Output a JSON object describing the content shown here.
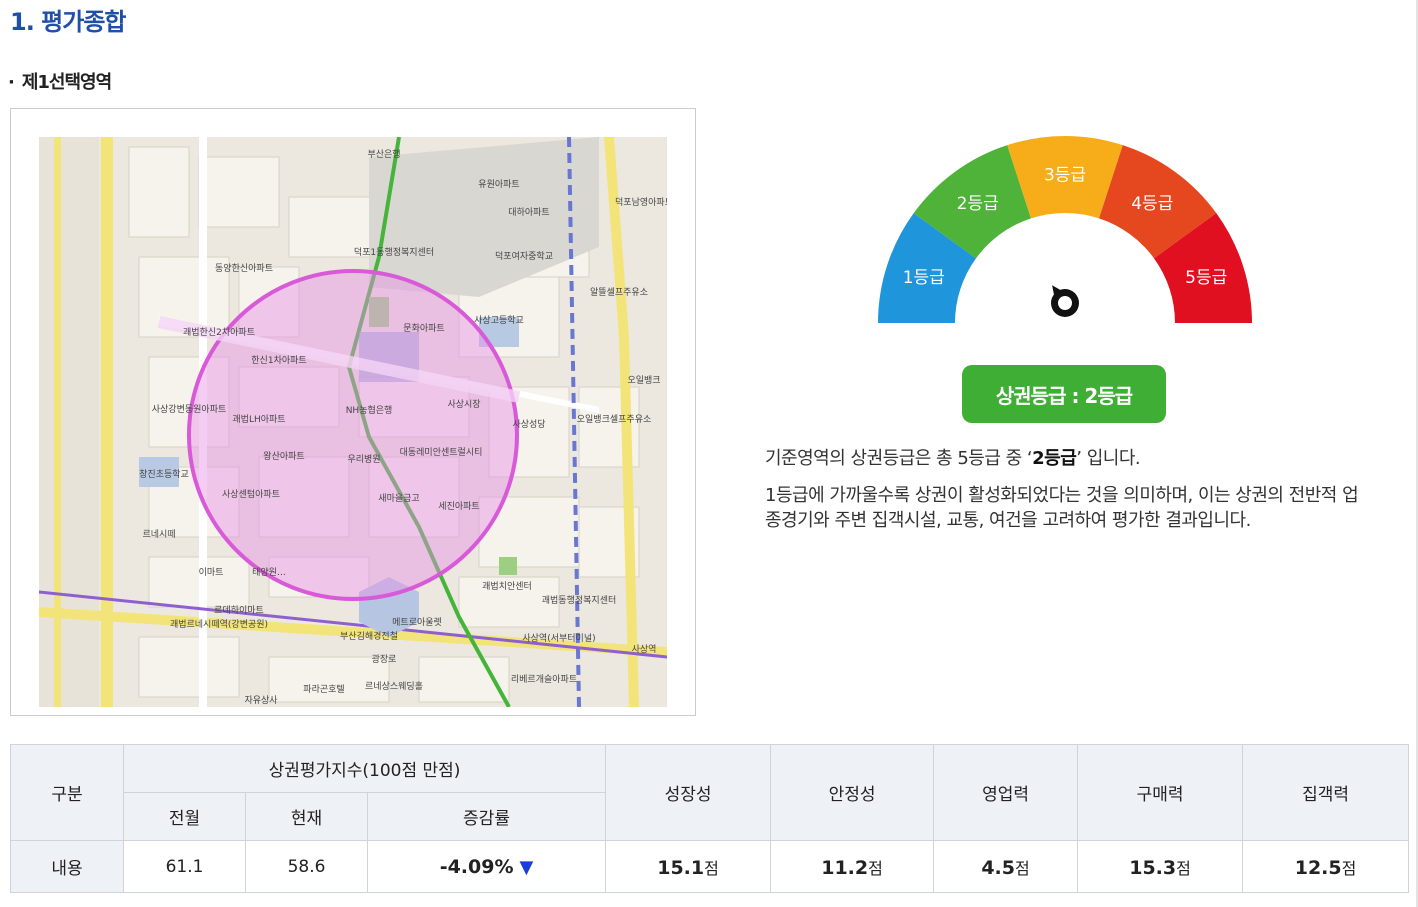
{
  "page_title": "1. 평가종합",
  "section": {
    "bullet": "·",
    "title": "제1선택영역"
  },
  "map": {
    "labels": [
      "부산은행",
      "유원아파트",
      "대하아파트",
      "덕포남영아파트",
      "덕포1동행정복지센터",
      "덕포여자중학교",
      "동양한신아파트",
      "알뜰셀프주유소",
      "사상고등학교",
      "괘법한신2차아파트",
      "문화아파트",
      "한신1차아파트",
      "오일뱅크",
      "사상강변동원아파트",
      "괘법LH아파트",
      "NH농협은행",
      "사상시장",
      "오일뱅크셀프주유소",
      "사상성당",
      "대동레미안센트럴시티",
      "창진초등학교",
      "왕산아파트",
      "우리병원",
      "사상센텀아파트",
      "새마을금고",
      "세진아파트",
      "르네시떼",
      "이마트",
      "태양원…",
      "괘법치안센터",
      "괘법동행정복지센터",
      "르데하이마트",
      "괘법르네시떼역(강변공원)",
      "부산김해경전철",
      "메트로아울렛",
      "광장로",
      "사상역",
      "리베르개슬아파트",
      "르네상스웨딩홀",
      "파라곤호텔",
      "자유상사",
      "사상역(서부터미널)"
    ]
  },
  "gauge": {
    "segments": [
      {
        "label": "1등급",
        "color": "#1f95dc"
      },
      {
        "label": "2등급",
        "color": "#4fb239"
      },
      {
        "label": "3등급",
        "color": "#f7ad1a"
      },
      {
        "label": "4등급",
        "color": "#e5481f"
      },
      {
        "label": "5등급",
        "color": "#e01020"
      }
    ],
    "pointer_grade": 2
  },
  "grade_badge": "상권등급 : 2등급",
  "description": {
    "line1_prefix": "기준영역의 상권등급은 총 5등급 중 ‘",
    "line1_grade": "2등급",
    "line1_suffix": "’ 입니다.",
    "line2": "1등급에 가까울수록 상권이 활성화되었다는 것을 의미하며, 이는 상권의 전반적 업종경기와 주변 집객시설, 교통, 여건을 고려하여 평가한 결과입니다."
  },
  "table": {
    "col_category": "구분",
    "index_header": "상권평가지수(100점 만점)",
    "sub_prev": "전월",
    "sub_curr": "현재",
    "sub_change": "증감률",
    "metric_headers": [
      "성장성",
      "안정성",
      "영업력",
      "구매력",
      "집객력"
    ],
    "row_label": "내용",
    "prev": "61.1",
    "curr": "58.6",
    "change": "-4.09%",
    "change_arrow": "▼",
    "unit": "점",
    "metric_values": [
      "15.1",
      "11.2",
      "4.5",
      "15.3",
      "12.5"
    ]
  }
}
